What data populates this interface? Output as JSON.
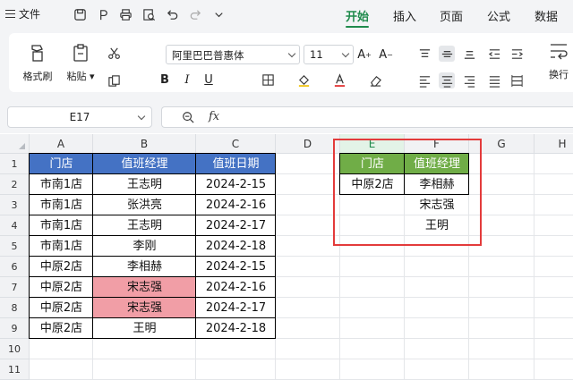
{
  "menubar": {
    "file_label": "文件",
    "tabs": [
      "开始",
      "插入",
      "页面",
      "公式",
      "数据"
    ],
    "active_tab": "开始"
  },
  "ribbon": {
    "format_painter": "格式刷",
    "paste": "粘贴",
    "font_name": "阿里巴巴普惠体",
    "font_size": "11",
    "wrap": "换行"
  },
  "formula_bar": {
    "name_box": "E17",
    "fx": "fx",
    "content": ""
  },
  "sheet": {
    "columns": [
      "A",
      "B",
      "C",
      "D",
      "E",
      "F",
      "G",
      "H"
    ],
    "rows": [
      "1",
      "2",
      "3",
      "4",
      "5",
      "6",
      "7",
      "8",
      "9",
      "10",
      "11"
    ],
    "table1": {
      "headers": [
        "门店",
        "值班经理",
        "值班日期"
      ],
      "rows": [
        [
          "市南1店",
          "王志明",
          "2024-2-15"
        ],
        [
          "市南1店",
          "张洪亮",
          "2024-2-16"
        ],
        [
          "市南1店",
          "王志明",
          "2024-2-17"
        ],
        [
          "市南1店",
          "李刚",
          "2024-2-18"
        ],
        [
          "中原2店",
          "李相赫",
          "2024-2-15"
        ],
        [
          "中原2店",
          "宋志强",
          "2024-2-16"
        ],
        [
          "中原2店",
          "宋志强",
          "2024-2-17"
        ],
        [
          "中原2店",
          "王明",
          "2024-2-18"
        ]
      ],
      "highlight_color": "#f19ea6",
      "header_color": "#4472c4"
    },
    "table2": {
      "headers": [
        "门店",
        "值班经理"
      ],
      "store": "中原2店",
      "managers": [
        "李相赫",
        "宋志强",
        "王明"
      ],
      "header_color": "#70ad47"
    },
    "annotation_color": "#e33b3b",
    "accent_color": "#1f8a4c"
  }
}
